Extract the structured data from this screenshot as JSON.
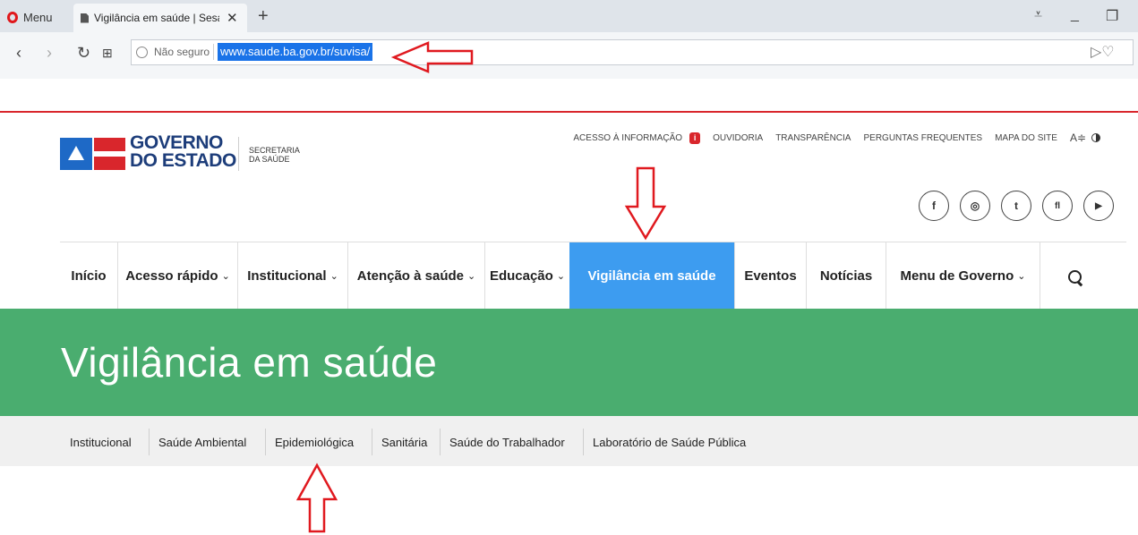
{
  "browser": {
    "menu_label": "Menu",
    "tab_title": "Vigilância em saúde | Sesa",
    "tab_close": "✕",
    "new_tab": "+",
    "not_secure": "Não seguro",
    "url": "www.saude.ba.gov.br/suvisa/"
  },
  "header": {
    "logo_line1": "GOVERNO",
    "logo_line2": "DO ESTADO",
    "secretaria_line1": "SECRETARIA",
    "secretaria_line2": "DA SAÚDE",
    "top_links": [
      "ACESSO À INFORMAÇÃO",
      "OUVIDORIA",
      "TRANSPARÊNCIA",
      "PERGUNTAS FREQUENTES",
      "MAPA DO SITE"
    ],
    "font_size_label": "A≑",
    "info_badge": "i",
    "social": [
      "f",
      "◎",
      "t",
      "fl",
      "▶"
    ]
  },
  "nav": {
    "items": [
      {
        "label": "Início"
      },
      {
        "label": "Acesso rápido"
      },
      {
        "label": "Institucional"
      },
      {
        "label": "Atenção à saúde"
      },
      {
        "label": "Educação"
      },
      {
        "label": "Vigilância em saúde"
      },
      {
        "label": "Eventos"
      },
      {
        "label": "Notícias"
      },
      {
        "label": "Menu de Governo"
      }
    ],
    "caret": "⌄"
  },
  "banner": {
    "title": "Vigilância em saúde"
  },
  "subnav": {
    "items": [
      "Institucional",
      "Saúde Ambiental",
      "Epidemiológica",
      "Sanitária",
      "Saúde do Trabalhador",
      "Laboratório de Saúde Pública"
    ]
  },
  "colors": {
    "nav_active": "#3d9cf0",
    "banner": "#4aad6f",
    "brand_red": "#d9262c",
    "brand_blue": "#1e69c6",
    "annotation": "#e0191f"
  }
}
